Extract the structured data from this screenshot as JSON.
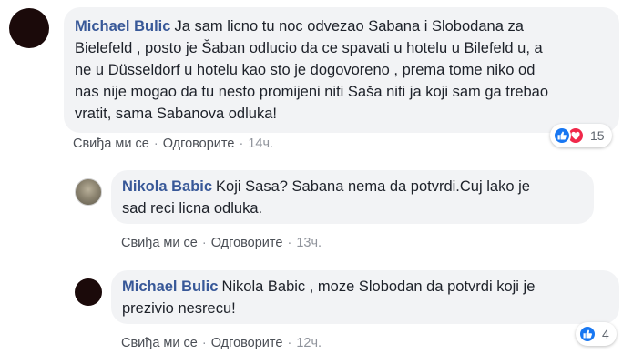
{
  "comments": [
    {
      "author": "Michael Bulic",
      "text_lines": [
        "Ja sam licno tu noc odvezao Sabana i Slobodana za",
        "Bielefeld , posto je Šaban odlucio da ce spavati u hotelu u Bilefeld u, a",
        "ne u Düsseldorf u hotelu kao sto je dogovoreno , prema tome niko od",
        "nas nije mogao da tu nesto promijeni niti Saša niti ja koji sam ga trebao",
        "vratit, sama Sabanova odluka!"
      ],
      "like_label": "Свиђа ми се",
      "reply_label": "Одговорите",
      "time": "14ч.",
      "reaction_count": "15",
      "reaction_icons": [
        "like-icon",
        "love-icon"
      ]
    },
    {
      "author": "Nikola Babic",
      "text_lines": [
        "Koji Sasa? Sabana nema da potvrdi.Cuj lako je",
        "sad reci licna odluka."
      ],
      "like_label": "Свиђа ми се",
      "reply_label": "Одговорите",
      "time": "13ч."
    },
    {
      "author": "Michael Bulic",
      "text_lines": [
        "Nikola Babic , moze Slobodan da potvrdi koji je",
        "prezivio nesrecu!"
      ],
      "like_label": "Свиђа ми се",
      "reply_label": "Одговорите",
      "time": "12ч.",
      "reaction_count": "4",
      "reaction_icons": [
        "like-icon"
      ]
    }
  ],
  "colors": {
    "author": "#385898",
    "bubble": "#f2f3f5",
    "like": "#1877f2",
    "love": "#f0284a"
  }
}
